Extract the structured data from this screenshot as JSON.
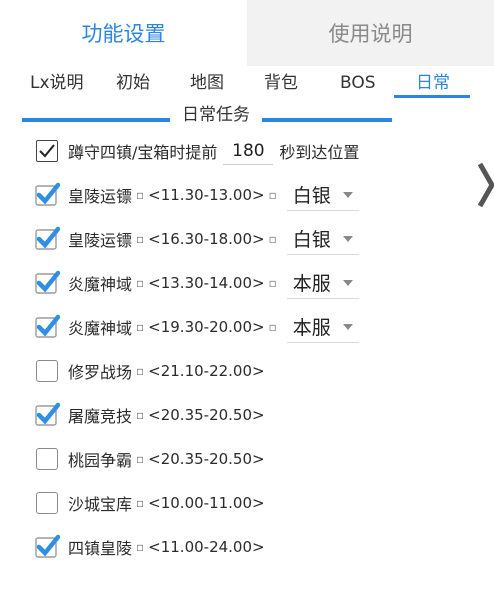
{
  "top_tabs": [
    {
      "label": "功能设置",
      "active": true
    },
    {
      "label": "使用说明",
      "active": false
    }
  ],
  "sub_tabs": [
    {
      "label": "Lx说明"
    },
    {
      "label": "初始"
    },
    {
      "label": "地图"
    },
    {
      "label": "背包"
    },
    {
      "label": "BOS"
    },
    {
      "label": "日常",
      "active": true
    }
  ],
  "section": {
    "title": "日常任务"
  },
  "guard_row": {
    "prefix": "蹲守四镇/宝箱时提前",
    "seconds": "180",
    "suffix": "秒到达位置",
    "checked": true
  },
  "tasks": [
    {
      "name": "皇陵运镖",
      "time": "<11.30-13.00>",
      "checked": true,
      "option": "白银"
    },
    {
      "name": "皇陵运镖",
      "time": "<16.30-18.00>",
      "checked": true,
      "option": "白银"
    },
    {
      "name": "炎魔神域",
      "time": "<13.30-14.00>",
      "checked": true,
      "option": "本服"
    },
    {
      "name": "炎魔神域",
      "time": "<19.30-20.00>",
      "checked": true,
      "option": "本服"
    },
    {
      "name": "修罗战场",
      "time": "<21.10-22.00>",
      "checked": false
    },
    {
      "name": "屠魔竞技",
      "time": "<20.35-20.50>",
      "checked": true
    },
    {
      "name": "桃园争霸",
      "time": "<20.35-20.50>",
      "checked": false
    },
    {
      "name": "沙城宝库",
      "time": "<10.00-11.00>",
      "checked": false
    },
    {
      "name": "四镇皇陵",
      "time": "<11.00-24.00>",
      "checked": true
    }
  ],
  "colors": {
    "accent": "#2a85e4",
    "check_blue": "#2f8fe6"
  },
  "icons": {
    "checkbox_checked": "check-icon",
    "side": "chevron-right-icon"
  }
}
